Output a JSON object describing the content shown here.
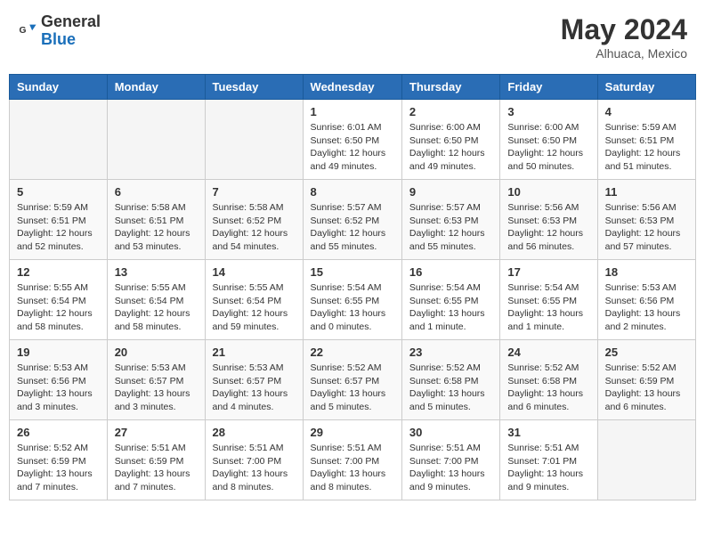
{
  "header": {
    "logo": {
      "general": "General",
      "blue": "Blue"
    },
    "title": "May 2024",
    "location": "Alhuaca, Mexico"
  },
  "calendar": {
    "days_of_week": [
      "Sunday",
      "Monday",
      "Tuesday",
      "Wednesday",
      "Thursday",
      "Friday",
      "Saturday"
    ],
    "weeks": [
      [
        {
          "day": "",
          "info": ""
        },
        {
          "day": "",
          "info": ""
        },
        {
          "day": "",
          "info": ""
        },
        {
          "day": "1",
          "info": "Sunrise: 6:01 AM\nSunset: 6:50 PM\nDaylight: 12 hours\nand 49 minutes."
        },
        {
          "day": "2",
          "info": "Sunrise: 6:00 AM\nSunset: 6:50 PM\nDaylight: 12 hours\nand 49 minutes."
        },
        {
          "day": "3",
          "info": "Sunrise: 6:00 AM\nSunset: 6:50 PM\nDaylight: 12 hours\nand 50 minutes."
        },
        {
          "day": "4",
          "info": "Sunrise: 5:59 AM\nSunset: 6:51 PM\nDaylight: 12 hours\nand 51 minutes."
        }
      ],
      [
        {
          "day": "5",
          "info": "Sunrise: 5:59 AM\nSunset: 6:51 PM\nDaylight: 12 hours\nand 52 minutes."
        },
        {
          "day": "6",
          "info": "Sunrise: 5:58 AM\nSunset: 6:51 PM\nDaylight: 12 hours\nand 53 minutes."
        },
        {
          "day": "7",
          "info": "Sunrise: 5:58 AM\nSunset: 6:52 PM\nDaylight: 12 hours\nand 54 minutes."
        },
        {
          "day": "8",
          "info": "Sunrise: 5:57 AM\nSunset: 6:52 PM\nDaylight: 12 hours\nand 55 minutes."
        },
        {
          "day": "9",
          "info": "Sunrise: 5:57 AM\nSunset: 6:53 PM\nDaylight: 12 hours\nand 55 minutes."
        },
        {
          "day": "10",
          "info": "Sunrise: 5:56 AM\nSunset: 6:53 PM\nDaylight: 12 hours\nand 56 minutes."
        },
        {
          "day": "11",
          "info": "Sunrise: 5:56 AM\nSunset: 6:53 PM\nDaylight: 12 hours\nand 57 minutes."
        }
      ],
      [
        {
          "day": "12",
          "info": "Sunrise: 5:55 AM\nSunset: 6:54 PM\nDaylight: 12 hours\nand 58 minutes."
        },
        {
          "day": "13",
          "info": "Sunrise: 5:55 AM\nSunset: 6:54 PM\nDaylight: 12 hours\nand 58 minutes."
        },
        {
          "day": "14",
          "info": "Sunrise: 5:55 AM\nSunset: 6:54 PM\nDaylight: 12 hours\nand 59 minutes."
        },
        {
          "day": "15",
          "info": "Sunrise: 5:54 AM\nSunset: 6:55 PM\nDaylight: 13 hours\nand 0 minutes."
        },
        {
          "day": "16",
          "info": "Sunrise: 5:54 AM\nSunset: 6:55 PM\nDaylight: 13 hours\nand 1 minute."
        },
        {
          "day": "17",
          "info": "Sunrise: 5:54 AM\nSunset: 6:55 PM\nDaylight: 13 hours\nand 1 minute."
        },
        {
          "day": "18",
          "info": "Sunrise: 5:53 AM\nSunset: 6:56 PM\nDaylight: 13 hours\nand 2 minutes."
        }
      ],
      [
        {
          "day": "19",
          "info": "Sunrise: 5:53 AM\nSunset: 6:56 PM\nDaylight: 13 hours\nand 3 minutes."
        },
        {
          "day": "20",
          "info": "Sunrise: 5:53 AM\nSunset: 6:57 PM\nDaylight: 13 hours\nand 3 minutes."
        },
        {
          "day": "21",
          "info": "Sunrise: 5:53 AM\nSunset: 6:57 PM\nDaylight: 13 hours\nand 4 minutes."
        },
        {
          "day": "22",
          "info": "Sunrise: 5:52 AM\nSunset: 6:57 PM\nDaylight: 13 hours\nand 5 minutes."
        },
        {
          "day": "23",
          "info": "Sunrise: 5:52 AM\nSunset: 6:58 PM\nDaylight: 13 hours\nand 5 minutes."
        },
        {
          "day": "24",
          "info": "Sunrise: 5:52 AM\nSunset: 6:58 PM\nDaylight: 13 hours\nand 6 minutes."
        },
        {
          "day": "25",
          "info": "Sunrise: 5:52 AM\nSunset: 6:59 PM\nDaylight: 13 hours\nand 6 minutes."
        }
      ],
      [
        {
          "day": "26",
          "info": "Sunrise: 5:52 AM\nSunset: 6:59 PM\nDaylight: 13 hours\nand 7 minutes."
        },
        {
          "day": "27",
          "info": "Sunrise: 5:51 AM\nSunset: 6:59 PM\nDaylight: 13 hours\nand 7 minutes."
        },
        {
          "day": "28",
          "info": "Sunrise: 5:51 AM\nSunset: 7:00 PM\nDaylight: 13 hours\nand 8 minutes."
        },
        {
          "day": "29",
          "info": "Sunrise: 5:51 AM\nSunset: 7:00 PM\nDaylight: 13 hours\nand 8 minutes."
        },
        {
          "day": "30",
          "info": "Sunrise: 5:51 AM\nSunset: 7:00 PM\nDaylight: 13 hours\nand 9 minutes."
        },
        {
          "day": "31",
          "info": "Sunrise: 5:51 AM\nSunset: 7:01 PM\nDaylight: 13 hours\nand 9 minutes."
        },
        {
          "day": "",
          "info": ""
        }
      ]
    ]
  }
}
